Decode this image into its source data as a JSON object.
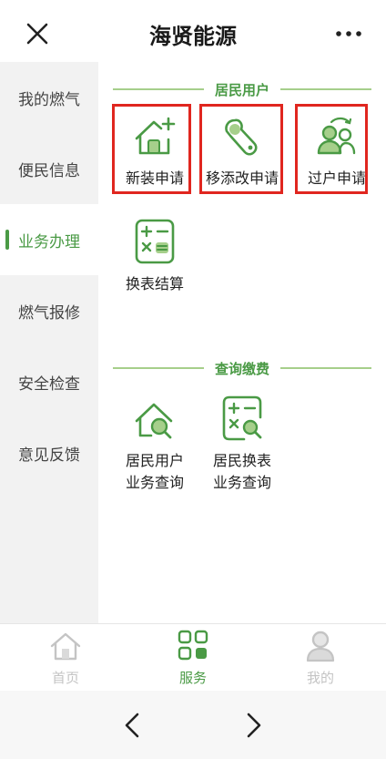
{
  "header": {
    "title": "海贤能源",
    "close_icon": "close-icon",
    "more_icon": "more-icon"
  },
  "sidebar": {
    "items": [
      {
        "label": "我的燃气"
      },
      {
        "label": "便民信息"
      },
      {
        "label": "业务办理",
        "active": true
      },
      {
        "label": "燃气报修"
      },
      {
        "label": "安全检查"
      },
      {
        "label": "意见反馈"
      }
    ]
  },
  "sections": [
    {
      "title": "居民用户",
      "tiles": [
        {
          "label": "新装申请",
          "icon": "house-plus-icon",
          "highlighted": true
        },
        {
          "label": "移添改申请",
          "icon": "wrench-icon",
          "highlighted": true
        },
        {
          "label": "过户申请",
          "icon": "users-transfer-icon",
          "highlighted": true
        },
        {
          "label": "换表结算",
          "icon": "calculator-icon"
        }
      ]
    },
    {
      "title": "查询缴费",
      "tiles": [
        {
          "label_line1": "居民用户",
          "label_line2": "业务查询",
          "icon": "house-search-icon"
        },
        {
          "label_line1": "居民换表",
          "label_line2": "业务查询",
          "icon": "calculator-search-icon"
        }
      ]
    }
  ],
  "tabbar": {
    "tabs": [
      {
        "label": "首页",
        "icon": "home-icon"
      },
      {
        "label": "服务",
        "icon": "grid-icon",
        "active": true
      },
      {
        "label": "我的",
        "icon": "person-icon"
      }
    ]
  },
  "nav": {
    "back_icon": "chevron-left-icon",
    "forward_icon": "chevron-right-icon"
  },
  "colors": {
    "accent": "#4a9a45",
    "highlight": "#e0261f",
    "sidebar_bg": "#f2f2f2",
    "inactive_tab": "#c4c4c4"
  }
}
